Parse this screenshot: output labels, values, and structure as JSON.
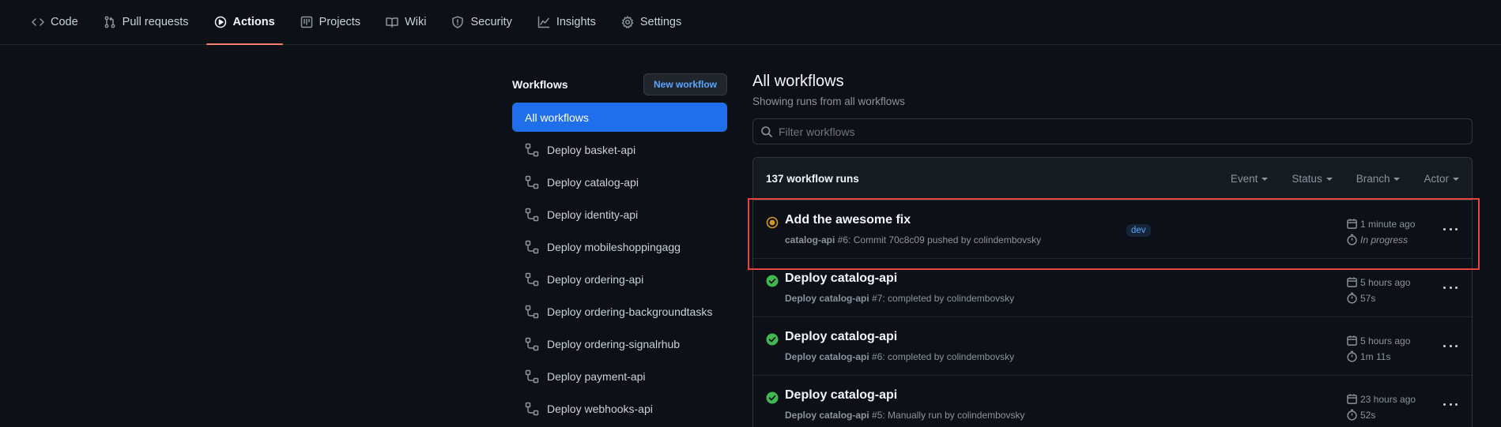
{
  "nav": {
    "tabs": [
      {
        "label": "Code",
        "icon": "code-icon"
      },
      {
        "label": "Pull requests",
        "icon": "pull-request-icon"
      },
      {
        "label": "Actions",
        "icon": "play-icon",
        "active": true
      },
      {
        "label": "Projects",
        "icon": "project-icon"
      },
      {
        "label": "Wiki",
        "icon": "book-icon"
      },
      {
        "label": "Security",
        "icon": "shield-icon"
      },
      {
        "label": "Insights",
        "icon": "graph-icon"
      },
      {
        "label": "Settings",
        "icon": "gear-icon"
      }
    ]
  },
  "sidebar": {
    "title": "Workflows",
    "new_button": "New workflow",
    "items": [
      {
        "label": "All workflows",
        "active": true
      },
      {
        "label": "Deploy basket-api"
      },
      {
        "label": "Deploy catalog-api"
      },
      {
        "label": "Deploy identity-api"
      },
      {
        "label": "Deploy mobileshoppingagg"
      },
      {
        "label": "Deploy ordering-api"
      },
      {
        "label": "Deploy ordering-backgroundtasks"
      },
      {
        "label": "Deploy ordering-signalrhub"
      },
      {
        "label": "Deploy payment-api"
      },
      {
        "label": "Deploy webhooks-api"
      }
    ]
  },
  "main": {
    "title": "All workflows",
    "subtitle": "Showing runs from all workflows",
    "filter_placeholder": "Filter workflows",
    "runs_count": "137 workflow runs",
    "filters": [
      "Event",
      "Status",
      "Branch",
      "Actor"
    ],
    "runs": [
      {
        "status": "in_progress",
        "title": "Add the awesome fix",
        "workflow": "catalog-api",
        "number": "#6",
        "detail": ": Commit 70c8c09 pushed by colindembovsky",
        "branch": "dev",
        "when": "1 minute ago",
        "duration": "In progress"
      },
      {
        "status": "success",
        "title": "Deploy catalog-api",
        "workflow": "Deploy catalog-api",
        "number": "#7",
        "detail": ": completed by colindembovsky",
        "branch": "",
        "when": "5 hours ago",
        "duration": "57s"
      },
      {
        "status": "success",
        "title": "Deploy catalog-api",
        "workflow": "Deploy catalog-api",
        "number": "#6",
        "detail": ": completed by colindembovsky",
        "branch": "",
        "when": "5 hours ago",
        "duration": "1m 11s"
      },
      {
        "status": "success",
        "title": "Deploy catalog-api",
        "workflow": "Deploy catalog-api",
        "number": "#5",
        "detail": ": Manually run by colindembovsky",
        "branch": "",
        "when": "23 hours ago",
        "duration": "52s"
      }
    ]
  },
  "colors": {
    "accent": "#1f6feb",
    "success": "#3fb950",
    "in_progress": "#d29922",
    "highlight": "#e5453d"
  }
}
